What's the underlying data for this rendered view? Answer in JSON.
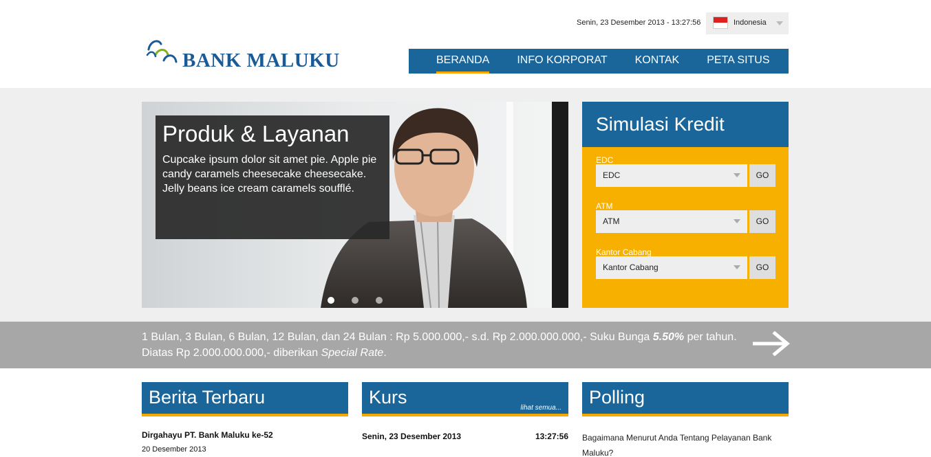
{
  "header": {
    "datetime": "Senin, 23 Desember 2013 - 13:27:56",
    "language": "Indonesia",
    "logo_text": "BANK MALUKU",
    "nav": [
      {
        "label": "BERANDA",
        "active": true
      },
      {
        "label": "INFO KORPORAT",
        "active": false
      },
      {
        "label": "KONTAK",
        "active": false
      },
      {
        "label": "PETA SITUS",
        "active": false
      }
    ]
  },
  "slider": {
    "title": "Produk & Layanan",
    "text": "Cupcake ipsum dolor sit amet pie. Apple pie candy caramels cheesecake cheesecake. Jelly beans ice cream caramels soufflé.",
    "dot_count": 3,
    "active_dot": 0
  },
  "simulasi": {
    "title": "Simulasi Kredit",
    "rows": [
      {
        "label": "EDC",
        "value": "EDC",
        "go": "GO"
      },
      {
        "label": "ATM",
        "value": "ATM",
        "go": "GO"
      },
      {
        "label": "Kantor Cabang",
        "value": "Kantor Cabang",
        "go": "GO"
      }
    ]
  },
  "strip": {
    "line1_prefix": "1 Bulan, 3 Bulan, 6 Bulan, 12 Bulan, dan 24 Bulan : Rp 5.000.000,- s.d. Rp 2.000.000.000,- Suku Bunga ",
    "rate": "5.50%",
    "line1_suffix": " per tahun.",
    "line2_prefix": "Diatas Rp 2.000.000.000,- diberikan ",
    "special": "Special Rate",
    "line2_suffix": "."
  },
  "berita": {
    "title": "Berita Terbaru",
    "item_title": "Dirgahayu PT. Bank Maluku ke-52",
    "item_date": "20 Desember 2013"
  },
  "kurs": {
    "title": "Kurs",
    "link": "lihat semua...",
    "date": "Senin, 23 Desember 2013",
    "time": "13:27:56"
  },
  "polling": {
    "title": "Polling",
    "question": "Bagaimana Menurut Anda Tentang Pelayanan Bank Maluku?"
  },
  "colors": {
    "brand_blue": "#1a6599",
    "accent_orange": "#f7b000",
    "strip_gray": "#a7a7a7"
  }
}
